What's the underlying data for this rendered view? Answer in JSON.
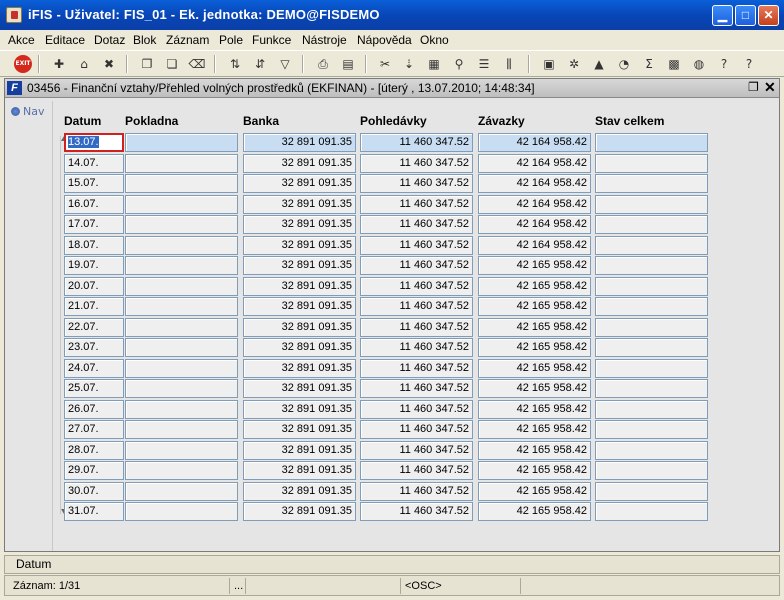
{
  "window": {
    "title": "iFIS - Uživatel: FIS_01 - Ek. jednotka: DEMO@FISDEMO"
  },
  "menu": [
    "Akce",
    "Editace",
    "Dotaz",
    "Blok",
    "Záznam",
    "Pole",
    "Funkce",
    "Nástroje",
    "Nápověda",
    "Okno"
  ],
  "toolbar": {
    "exit_label": "EXIT"
  },
  "form": {
    "title": "03456 - Finanční vztahy/Přehled volných prostředků (EKFINAN) - [úterý  , 13.07.2010; 14:48:34]",
    "nav_label": "Nav",
    "columns": [
      "Datum",
      "Pokladna",
      "Banka",
      "Pohledávky",
      "Závazky",
      "Stav celkem"
    ],
    "rows": [
      {
        "datum": "13.07.",
        "pokladna": "",
        "banka": "32 891 091.35",
        "pohledavky": "11 460 347.52",
        "zavazky": "42 164 958.42",
        "stav": ""
      },
      {
        "datum": "14.07.",
        "pokladna": "",
        "banka": "32 891 091.35",
        "pohledavky": "11 460 347.52",
        "zavazky": "42 164 958.42",
        "stav": ""
      },
      {
        "datum": "15.07.",
        "pokladna": "",
        "banka": "32 891 091.35",
        "pohledavky": "11 460 347.52",
        "zavazky": "42 164 958.42",
        "stav": ""
      },
      {
        "datum": "16.07.",
        "pokladna": "",
        "banka": "32 891 091.35",
        "pohledavky": "11 460 347.52",
        "zavazky": "42 164 958.42",
        "stav": ""
      },
      {
        "datum": "17.07.",
        "pokladna": "",
        "banka": "32 891 091.35",
        "pohledavky": "11 460 347.52",
        "zavazky": "42 164 958.42",
        "stav": ""
      },
      {
        "datum": "18.07.",
        "pokladna": "",
        "banka": "32 891 091.35",
        "pohledavky": "11 460 347.52",
        "zavazky": "42 164 958.42",
        "stav": ""
      },
      {
        "datum": "19.07.",
        "pokladna": "",
        "banka": "32 891 091.35",
        "pohledavky": "11 460 347.52",
        "zavazky": "42 165 958.42",
        "stav": ""
      },
      {
        "datum": "20.07.",
        "pokladna": "",
        "banka": "32 891 091.35",
        "pohledavky": "11 460 347.52",
        "zavazky": "42 165 958.42",
        "stav": ""
      },
      {
        "datum": "21.07.",
        "pokladna": "",
        "banka": "32 891 091.35",
        "pohledavky": "11 460 347.52",
        "zavazky": "42 165 958.42",
        "stav": ""
      },
      {
        "datum": "22.07.",
        "pokladna": "",
        "banka": "32 891 091.35",
        "pohledavky": "11 460 347.52",
        "zavazky": "42 165 958.42",
        "stav": ""
      },
      {
        "datum": "23.07.",
        "pokladna": "",
        "banka": "32 891 091.35",
        "pohledavky": "11 460 347.52",
        "zavazky": "42 165 958.42",
        "stav": ""
      },
      {
        "datum": "24.07.",
        "pokladna": "",
        "banka": "32 891 091.35",
        "pohledavky": "11 460 347.52",
        "zavazky": "42 165 958.42",
        "stav": ""
      },
      {
        "datum": "25.07.",
        "pokladna": "",
        "banka": "32 891 091.35",
        "pohledavky": "11 460 347.52",
        "zavazky": "42 165 958.42",
        "stav": ""
      },
      {
        "datum": "26.07.",
        "pokladna": "",
        "banka": "32 891 091.35",
        "pohledavky": "11 460 347.52",
        "zavazky": "42 165 958.42",
        "stav": ""
      },
      {
        "datum": "27.07.",
        "pokladna": "",
        "banka": "32 891 091.35",
        "pohledavky": "11 460 347.52",
        "zavazky": "42 165 958.42",
        "stav": ""
      },
      {
        "datum": "28.07.",
        "pokladna": "",
        "banka": "32 891 091.35",
        "pohledavky": "11 460 347.52",
        "zavazky": "42 165 958.42",
        "stav": ""
      },
      {
        "datum": "29.07.",
        "pokladna": "",
        "banka": "32 891 091.35",
        "pohledavky": "11 460 347.52",
        "zavazky": "42 165 958.42",
        "stav": ""
      },
      {
        "datum": "30.07.",
        "pokladna": "",
        "banka": "32 891 091.35",
        "pohledavky": "11 460 347.52",
        "zavazky": "42 165 958.42",
        "stav": ""
      },
      {
        "datum": "31.07.",
        "pokladna": "",
        "banka": "32 891 091.35",
        "pohledavky": "11 460 347.52",
        "zavazky": "42 165 958.42",
        "stav": ""
      }
    ]
  },
  "status": {
    "field_label": "Datum",
    "record": "Záznam: 1/31",
    "ellipsis": "...",
    "mode": "<OSC>"
  },
  "colors": {
    "titlebar": "#0845B5",
    "selected_cell": "#C8DDF2",
    "focus_border": "#D02020"
  }
}
